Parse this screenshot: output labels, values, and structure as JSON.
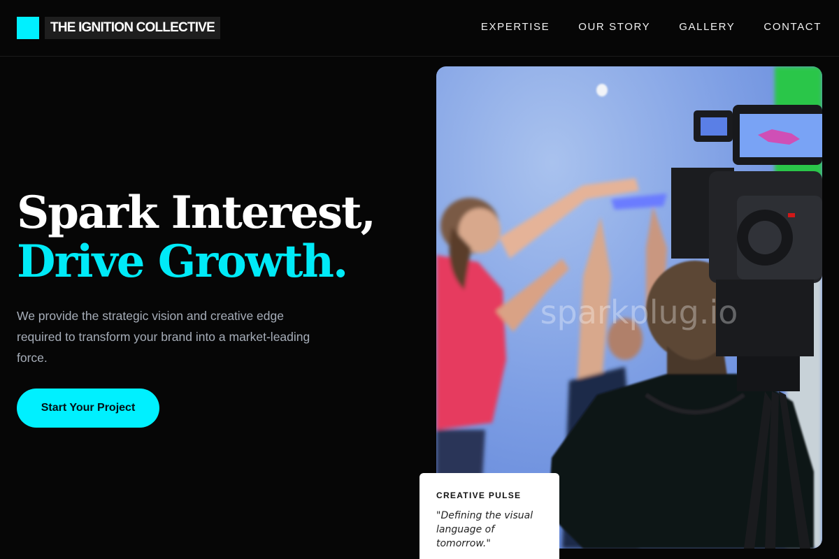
{
  "brand": {
    "name": "THE IGNITION COLLECTIVE",
    "accent": "#00f0ff"
  },
  "nav": {
    "items": [
      "EXPERTISE",
      "OUR STORY",
      "GALLERY",
      "CONTACT"
    ]
  },
  "hero": {
    "headline_line1": "Spark Interest,",
    "headline_line2": "Drive Growth.",
    "description": "We provide the strategic vision and creative edge required to transform your brand into a market-leading force.",
    "cta_label": "Start Your Project",
    "image_watermark": "sparkplug.io"
  },
  "card": {
    "title": "CREATIVE PULSE",
    "quote": "\"Defining the visual language of tomorrow.\""
  }
}
